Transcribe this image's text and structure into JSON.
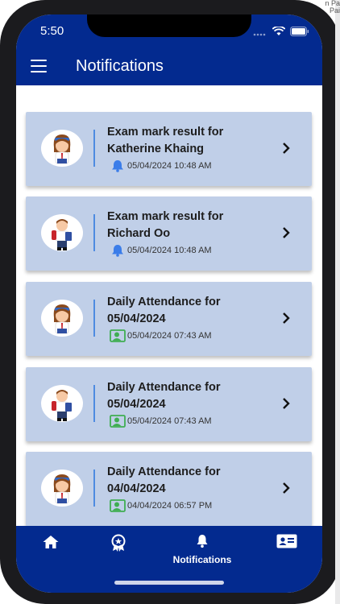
{
  "status_bar": {
    "time": "5:50"
  },
  "corner_text": "n Pa Pai",
  "app_bar": {
    "title": "Notifications"
  },
  "notifications": [
    {
      "title_line1": "Exam mark result for",
      "title_line2": "Katherine Khaing",
      "datetime": "05/04/2024 10:48 AM",
      "type": "bell-icon",
      "avatar": "girl-avatar"
    },
    {
      "title_line1": "Exam mark result for",
      "title_line2": "Richard Oo",
      "datetime": "05/04/2024 10:48 AM",
      "type": "bell-icon",
      "avatar": "boy-avatar"
    },
    {
      "title_line1": "Daily Attendance for",
      "title_line2": "05/04/2024",
      "datetime": "05/04/2024 07:43 AM",
      "type": "attendance-icon",
      "avatar": "girl-avatar"
    },
    {
      "title_line1": "Daily Attendance for",
      "title_line2": "05/04/2024",
      "datetime": "05/04/2024 07:43 AM",
      "type": "attendance-icon",
      "avatar": "boy-avatar"
    },
    {
      "title_line1": "Daily Attendance for",
      "title_line2": "04/04/2024",
      "datetime": "04/04/2024 06:57 PM",
      "type": "attendance-icon",
      "avatar": "girl-avatar"
    }
  ],
  "bottom_nav": {
    "items": [
      {
        "icon": "home-icon",
        "label": ""
      },
      {
        "icon": "award-icon",
        "label": ""
      },
      {
        "icon": "bell-icon",
        "label": "Notifications",
        "active": true
      },
      {
        "icon": "contact-card-icon",
        "label": ""
      }
    ]
  },
  "colors": {
    "primary": "#032a8f",
    "card": "#c0cfe8",
    "bell": "#3b7de9",
    "attendance": "#3fae52"
  }
}
